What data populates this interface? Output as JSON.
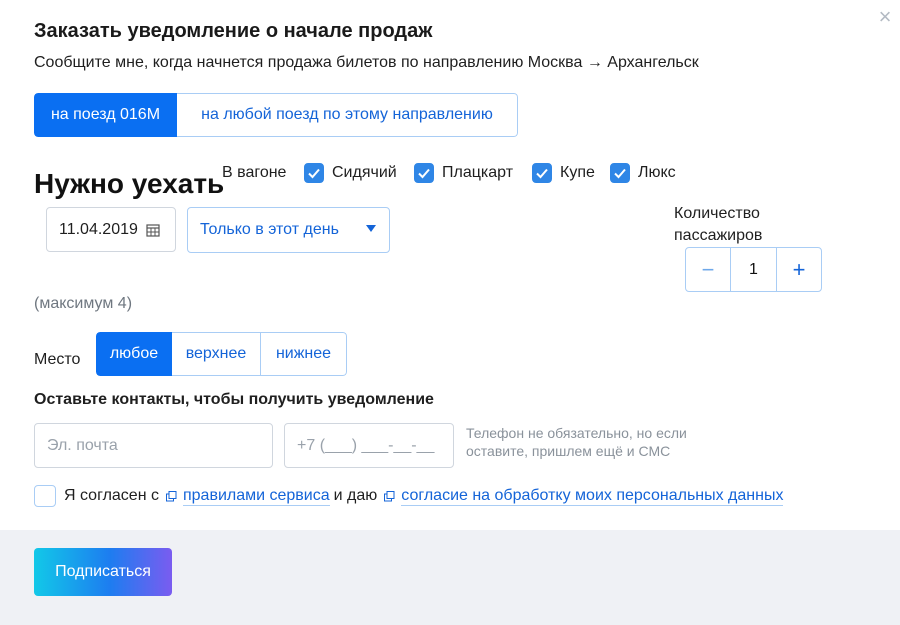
{
  "modal": {
    "title": "Заказать уведомление о начале продаж",
    "subtitle": "Сообщите мне, когда начнется продажа билетов по направлению Москва → Архангельск",
    "close_icon": "close-icon"
  },
  "train_choice": {
    "options": [
      "на поезд 016М",
      "на любой поезд по этому направлению"
    ],
    "active_index": 0
  },
  "departure": {
    "heading": "Нужно уехать",
    "date_value": "11.04.2019",
    "calendar_icon": "calendar-icon",
    "day_option": "Только в этот день",
    "dropdown_icon": "chevron-down-icon"
  },
  "wagon": {
    "label": "В вагоне",
    "types": [
      {
        "label": "Сидячий",
        "checked": true
      },
      {
        "label": "Плацкарт",
        "checked": true
      },
      {
        "label": "Купе",
        "checked": true
      },
      {
        "label": "Люкс",
        "checked": true
      }
    ]
  },
  "passengers": {
    "label": "Количество пассажиров",
    "value": "1",
    "minus": "−",
    "plus": "+",
    "max_note": "(максимум 4)"
  },
  "seat": {
    "label": "Место",
    "options": [
      "любое",
      "верхнее",
      "нижнее"
    ],
    "active_index": 0
  },
  "contacts": {
    "title": "Оставьте контакты, чтобы получить уведомление",
    "email_placeholder": "Эл. почта",
    "phone_placeholder": "+7 (___) ___-__-__",
    "phone_hint": "Телефон не обязательно, но если оставите, пришлем ещё и СМС"
  },
  "agreement": {
    "prefix": "Я согласен с",
    "rules_link": "правилами сервиса",
    "middle": "и даю",
    "consent_link": "согласие на обработку моих персональных данных",
    "external_icon": "external-link-icon"
  },
  "footer": {
    "submit_label": "Подписаться"
  },
  "colors": {
    "accent": "#0a6ff2",
    "link": "#1464d8",
    "border": "#a9cdf5",
    "footer_bg": "#eff1f5"
  }
}
